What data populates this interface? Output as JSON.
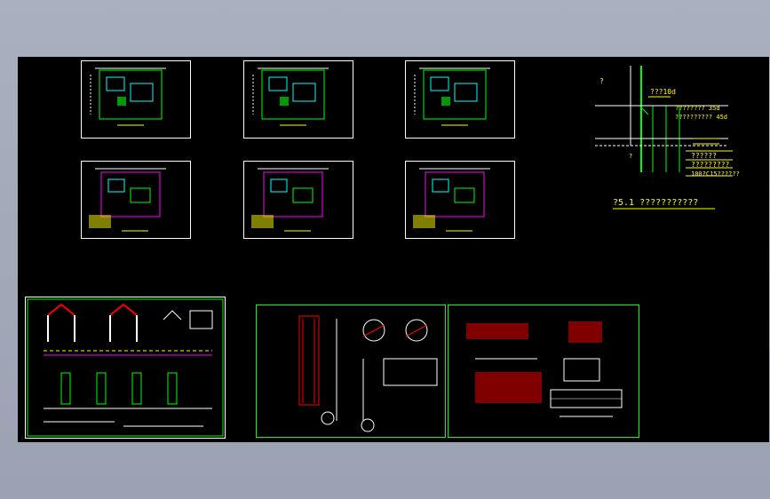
{
  "detail": {
    "labels": [
      {
        "text": "?"
      },
      {
        "text": "???10d"
      },
      {
        "text": "???????? 35d"
      },
      {
        "text": "?????????? 45d"
      },
      {
        "text": "?"
      },
      {
        "text": "??????"
      },
      {
        "text": "?????????"
      },
      {
        "text": "100?C15??????"
      }
    ],
    "title": "?5.1  ???????????"
  },
  "colors": {
    "background": "#000000",
    "frame": "#00ff00",
    "sheet_border": "#ffffff",
    "annotation": "#ffff00",
    "wall": "#ffffff",
    "hatch": "#ff00ff",
    "pipe": "#00ffff",
    "dimension": "#ff0000"
  }
}
